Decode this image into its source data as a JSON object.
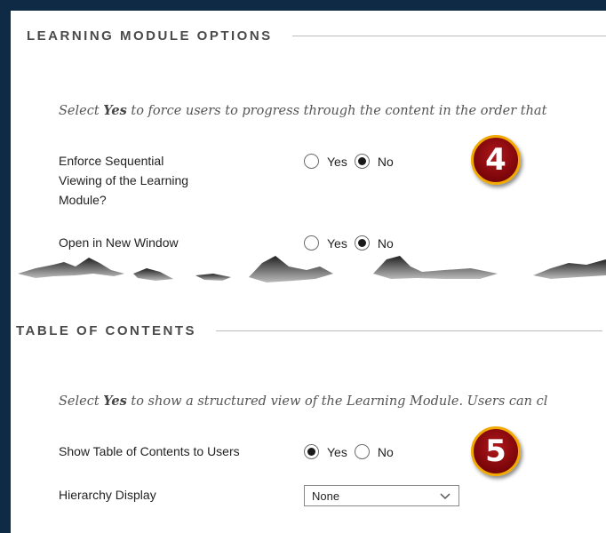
{
  "learning_module": {
    "title": "LEARNING MODULE OPTIONS",
    "instruction": {
      "before": "Select ",
      "bold": "Yes",
      "after": " to force users to progress through the content in the order that"
    },
    "sequential": {
      "label_lines": [
        "Enforce Sequential",
        "Viewing of the Learning",
        "Module?"
      ],
      "yes": "Yes",
      "no": "No",
      "selected": "No"
    },
    "new_window": {
      "label": "Open in New Window",
      "yes": "Yes",
      "no": "No",
      "selected": "No"
    },
    "badge": "4"
  },
  "toc": {
    "title": "TABLE OF CONTENTS",
    "instruction": {
      "before": "Select ",
      "bold": "Yes",
      "after": " to show a structured view of the Learning Module. Users can cl"
    },
    "show_toc": {
      "label": "Show Table of Contents to Users",
      "yes": "Yes",
      "no": "No",
      "selected": "Yes"
    },
    "hierarchy": {
      "label": "Hierarchy Display",
      "value": "None"
    },
    "badge": "5"
  },
  "colors": {
    "frame": "#0f2a44",
    "badge_fill": "#8b0a0e",
    "badge_ring": "#f2a900"
  }
}
